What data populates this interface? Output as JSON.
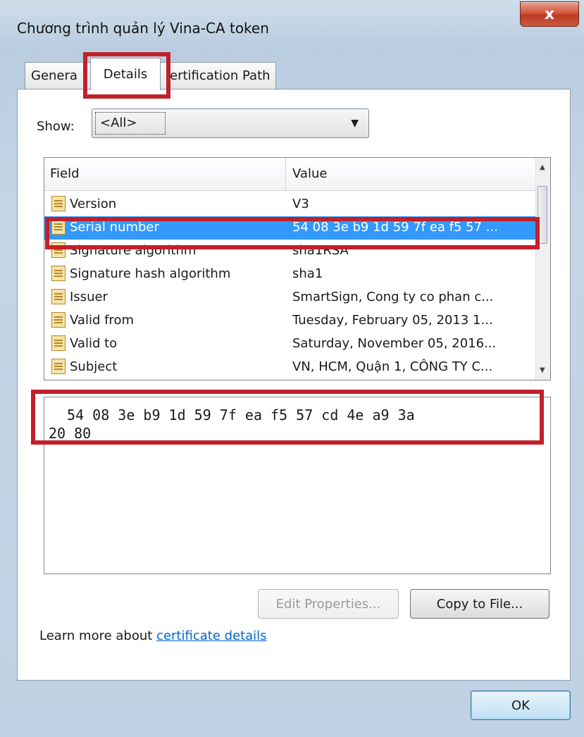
{
  "window": {
    "title": "Chương trình quản lý Vina-CA token",
    "close_label": "x"
  },
  "tabs": [
    {
      "label": "Genera",
      "selected": false
    },
    {
      "label": "Details",
      "selected": true
    },
    {
      "label": "ertification Path",
      "selected": false
    }
  ],
  "show": {
    "label": "Show:",
    "value": "<All>"
  },
  "fields_list": {
    "columns": [
      "Field",
      "Value"
    ],
    "rows": [
      {
        "field": "Version",
        "value": "V3",
        "selected": false
      },
      {
        "field": "Serial number",
        "value": "54 08 3e b9 1d 59 7f ea f5 57 ...",
        "selected": true
      },
      {
        "field": "Signature algorithm",
        "value": "sha1RSA",
        "selected": false
      },
      {
        "field": "Signature hash algorithm",
        "value": "sha1",
        "selected": false
      },
      {
        "field": "Issuer",
        "value": "SmartSign, Cong ty co phan c...",
        "selected": false
      },
      {
        "field": "Valid from",
        "value": "Tuesday, February 05, 2013 1...",
        "selected": false
      },
      {
        "field": "Valid to",
        "value": "Saturday, November 05, 2016...",
        "selected": false
      },
      {
        "field": "Subject",
        "value": "VN, HCM, Quận 1, CÔNG TY C...",
        "selected": false
      }
    ]
  },
  "detail": {
    "line1": " 54 08 3e b9 1d 59 7f ea f5 57 cd 4e a9 3a",
    "line2": "20 80"
  },
  "buttons": {
    "edit_properties": "Edit Properties...",
    "copy_to_file": "Copy to File...",
    "ok": "OK"
  },
  "learn_more": {
    "text": "Learn more about ",
    "link": "certificate details"
  },
  "colors": {
    "highlight_red": "#c2202a",
    "selection_blue": "#3399ff",
    "link_blue": "#0066cc"
  }
}
